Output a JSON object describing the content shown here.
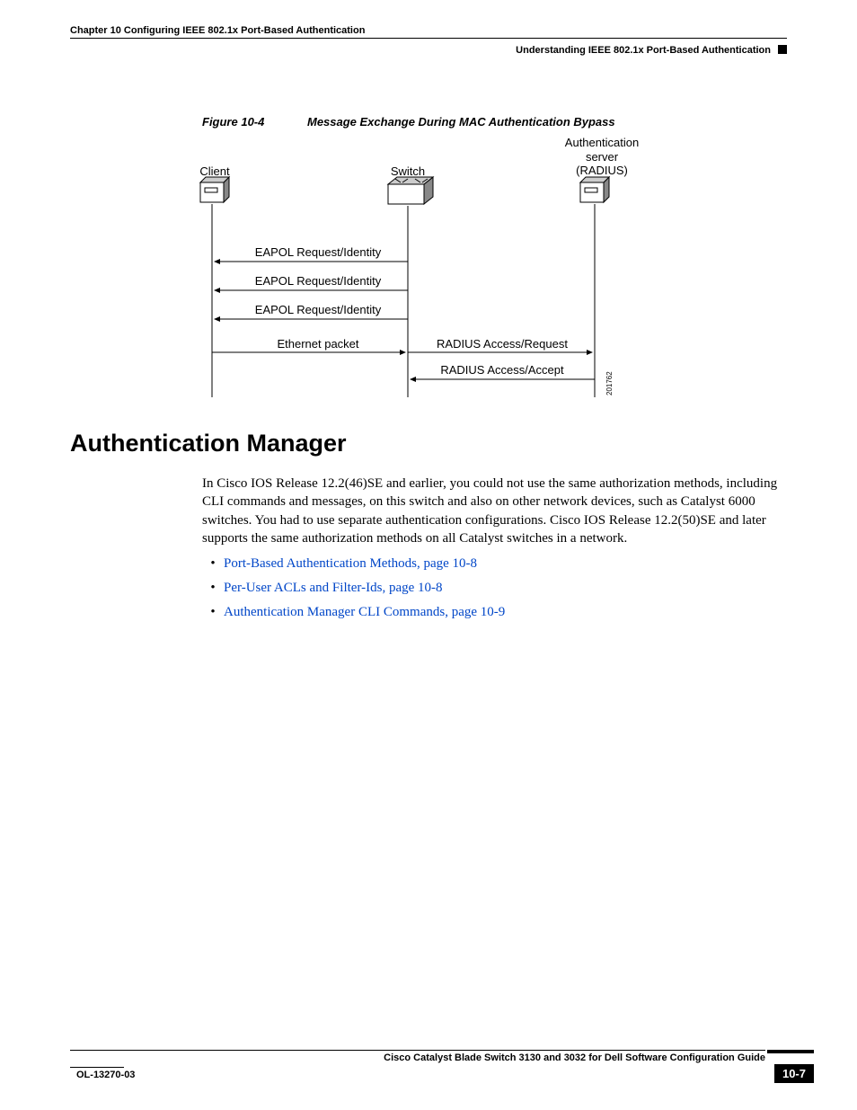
{
  "header": {
    "chapter": "Chapter 10      Configuring IEEE 802.1x Port-Based Authentication",
    "section": "Understanding IEEE 802.1x Port-Based Authentication"
  },
  "figure": {
    "number": "Figure 10-4",
    "title": "Message Exchange During MAC Authentication Bypass",
    "labels": {
      "client": "Client",
      "switch": "Switch",
      "server_line1": "Authentication",
      "server_line2": "server",
      "server_line3": "(RADIUS)",
      "msg1": "EAPOL Request/Identity",
      "msg2": "EAPOL Request/Identity",
      "msg3": "EAPOL Request/Identity",
      "msg4": "Ethernet packet",
      "msg5": "RADIUS Access/Request",
      "msg6": "RADIUS Access/Accept",
      "imgnum": "201762"
    }
  },
  "heading": "Authentication Manager",
  "paragraph": "In Cisco IOS Release 12.2(46)SE and earlier, you could not use the same authorization methods, including CLI commands and messages, on this switch and also on other network devices, such as Catalyst 6000 switches. You had to use separate authentication configurations. Cisco IOS Release 12.2(50)SE and later supports the same authorization methods on all Catalyst switches in a network.",
  "links": [
    "Port-Based Authentication Methods, page 10-8",
    "Per-User ACLs and Filter-Ids, page 10-8",
    "Authentication Manager CLI Commands, page 10-9"
  ],
  "footer": {
    "guide": "Cisco Catalyst Blade Switch 3130 and 3032 for Dell Software Configuration Guide",
    "docnum": "OL-13270-03",
    "page": "10-7"
  }
}
